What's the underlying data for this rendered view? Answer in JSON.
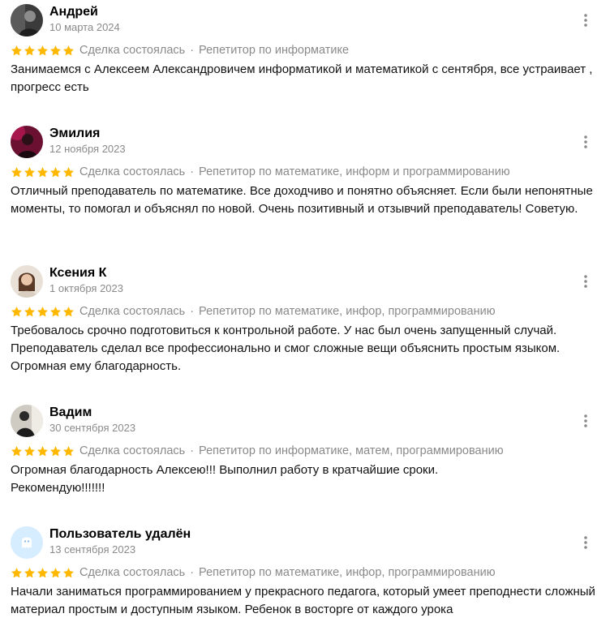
{
  "reviews": [
    {
      "name": "Андрей",
      "date": "10 марта 2024",
      "rating": 5,
      "deal_status": "Сделка состоялась",
      "category": "Репетитор по информатике",
      "text": "Занимаемся с Алексеем Александровичем информатикой и математикой с сентября, все устраивает , прогресс есть",
      "avatar_icon": "user-photo-icon"
    },
    {
      "name": "Эмилия",
      "date": "12 ноября 2023",
      "rating": 5,
      "deal_status": "Сделка состоялась",
      "category": "Репетитор по математике, информ и программированию",
      "text": "Отличный преподаватель по математике. Все доходчиво и понятно объясняет. Если были непонятные моменты, то помогал и объяснял по новой. Очень позитивный и отзывчий преподаватель! Советую.",
      "avatar_icon": "user-photo-icon"
    },
    {
      "name": "Ксения К",
      "date": "1 октября 2023",
      "rating": 5,
      "deal_status": "Сделка состоялась",
      "category": "Репетитор по математике, инфор, программированию",
      "text": "Требовалось срочно подготовиться к контрольной работе. У нас был очень запущенный случай. Преподаватель сделал все профессионально и смог сложные вещи объяснить простым языком. Огромная ему благодарность.",
      "avatar_icon": "user-photo-icon"
    },
    {
      "name": "Вадим",
      "date": "30 сентября 2023",
      "rating": 5,
      "deal_status": "Сделка состоялась",
      "category": "Репетитор по информатике, матем, программированию",
      "text": "Огромная благодарность Алексею!!! Выполнил работу в кратчайшие сроки.\nРекомендую!!!!!!!",
      "avatar_icon": "user-photo-icon"
    },
    {
      "name": "Пользователь удалён",
      "date": "13 сентября 2023",
      "rating": 5,
      "deal_status": "Сделка состоялась",
      "category": "Репетитор по математике, инфор, программированию",
      "text": "Начали заниматься программированием у прекрасного педагога, который умеет преподнести сложный материал простым и доступным языком. Ребенок в восторге от каждого урока",
      "avatar_icon": "ghost-icon"
    }
  ],
  "colors": {
    "star": "#FFB800",
    "muted_text": "#8a8a8a",
    "ghost_avatar_bg": "#d6ecff",
    "more_icon": "#8a8a8a"
  }
}
